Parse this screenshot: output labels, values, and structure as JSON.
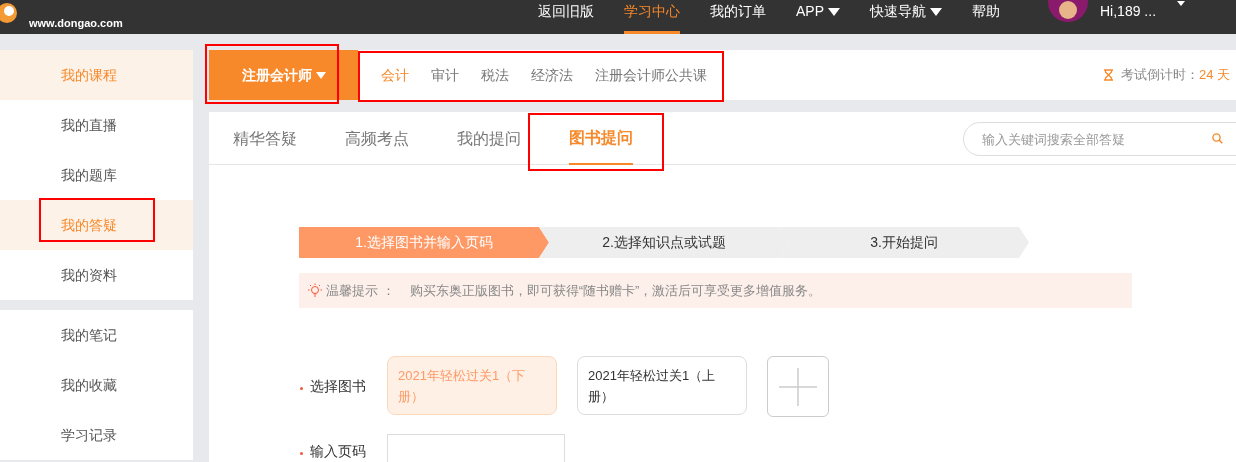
{
  "header": {
    "site_url": "www.dongao.com",
    "nav": [
      {
        "label": "返回旧版",
        "selected": false,
        "dropdown": false
      },
      {
        "label": "学习中心",
        "selected": true,
        "dropdown": false
      },
      {
        "label": "我的订单",
        "selected": false,
        "dropdown": false
      },
      {
        "label": "APP",
        "selected": false,
        "dropdown": true
      },
      {
        "label": "快速导航",
        "selected": false,
        "dropdown": true
      },
      {
        "label": "帮助",
        "selected": false,
        "dropdown": false
      }
    ],
    "user": "Hi,189 ..."
  },
  "sidebar": {
    "groups": [
      [
        {
          "label": "我的课程",
          "selected": true,
          "highlighted": false
        },
        {
          "label": "我的直播",
          "selected": false,
          "highlighted": false
        },
        {
          "label": "我的题库",
          "selected": false,
          "highlighted": false
        },
        {
          "label": "我的答疑",
          "selected": true,
          "highlighted": true
        },
        {
          "label": "我的资料",
          "selected": false,
          "highlighted": false
        }
      ],
      [
        {
          "label": "我的笔记",
          "selected": false,
          "highlighted": false
        },
        {
          "label": "我的收藏",
          "selected": false,
          "highlighted": false
        },
        {
          "label": "学习记录",
          "selected": false,
          "highlighted": false
        }
      ]
    ]
  },
  "exam_select": {
    "label": "注册会计师",
    "highlighted": true
  },
  "subjects": {
    "highlighted": true,
    "items": [
      {
        "label": "会计",
        "selected": true
      },
      {
        "label": "审计",
        "selected": false
      },
      {
        "label": "税法",
        "selected": false
      },
      {
        "label": "经济法",
        "selected": false
      },
      {
        "label": "注册会计师公共课",
        "selected": false
      }
    ]
  },
  "countdown": {
    "label": "考试倒计时：",
    "value": "24 天"
  },
  "tabs": [
    {
      "label": "精华答疑",
      "selected": false,
      "highlighted": false
    },
    {
      "label": "高频考点",
      "selected": false,
      "highlighted": false
    },
    {
      "label": "我的提问",
      "selected": false,
      "highlighted": false
    },
    {
      "label": "图书提问",
      "selected": true,
      "highlighted": true
    }
  ],
  "search": {
    "placeholder": "输入关键词搜索全部答疑"
  },
  "steps": [
    {
      "label": "1.选择图书并输入页码",
      "selected": true
    },
    {
      "label": "2.选择知识点或试题",
      "selected": false
    },
    {
      "label": "3.开始提问",
      "selected": false
    }
  ],
  "tip": {
    "label": "温馨提示 ：",
    "text": "购买东奥正版图书，即可获得“随书赠卡”，激活后可享受更多增值服务。"
  },
  "form": {
    "book_label": "选择图书",
    "books": [
      {
        "title": "2021年轻松过关1（下册）",
        "selected": true
      },
      {
        "title": "2021年轻松过关1（上册）",
        "selected": false
      }
    ],
    "page_label": "输入页码"
  }
}
